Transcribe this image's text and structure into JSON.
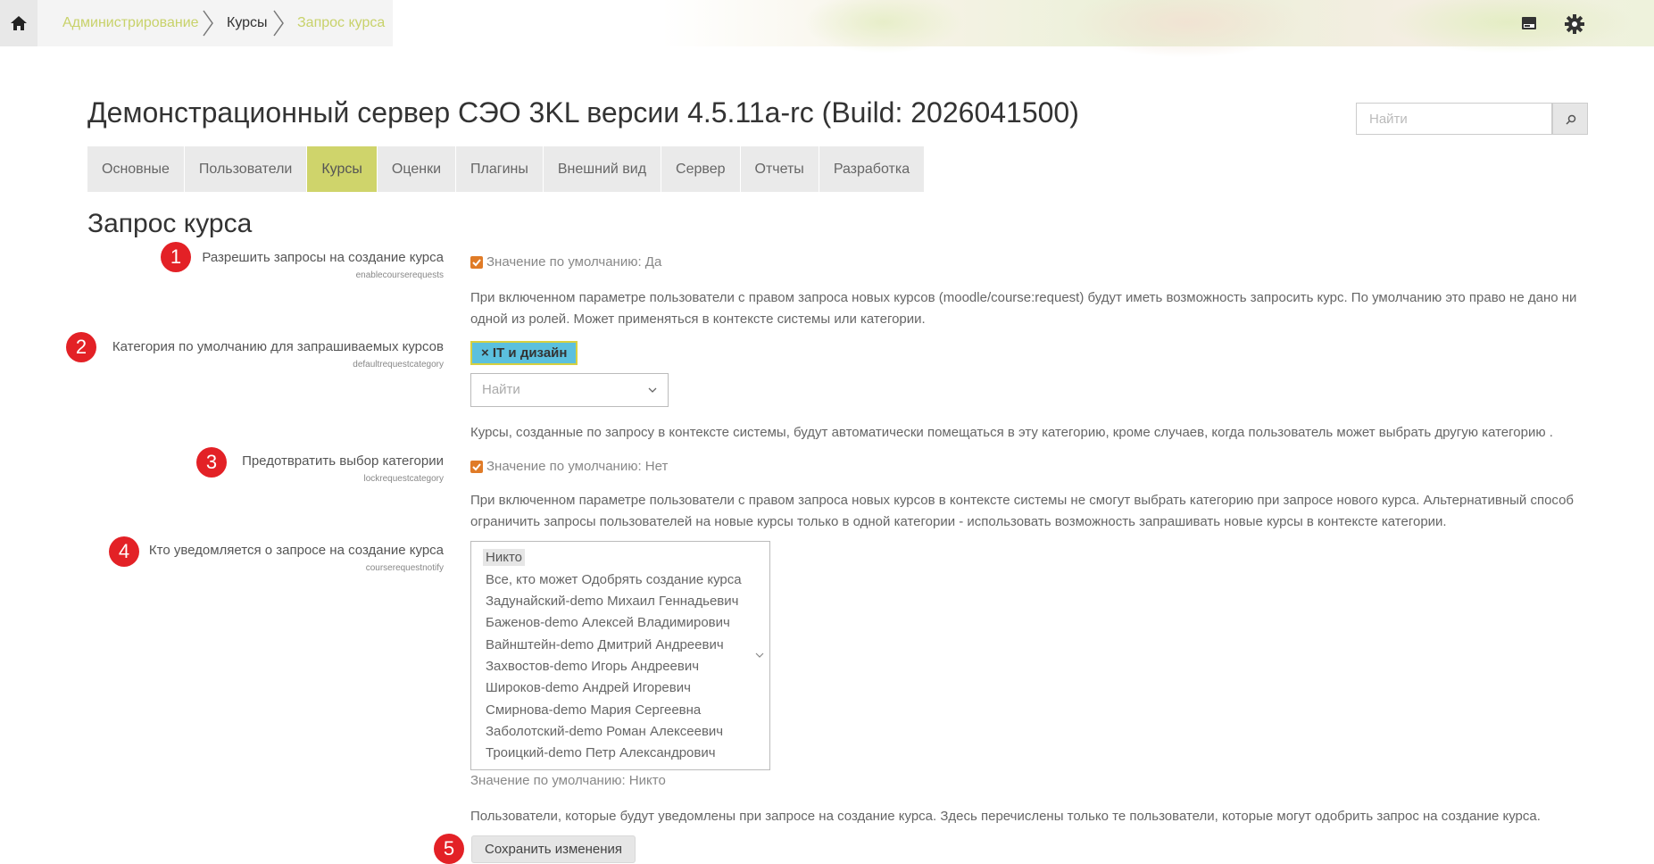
{
  "breadcrumb": {
    "items": [
      {
        "label": "Администрирование"
      },
      {
        "label": "Курсы"
      },
      {
        "label": "Запрос курса"
      }
    ]
  },
  "header": {
    "title": "Демонстрационный сервер СЭО 3KL версии 4.5.11a-rc (Build: 2026041500)",
    "search_placeholder": "Найти"
  },
  "tabs": [
    {
      "label": "Основные"
    },
    {
      "label": "Пользователи"
    },
    {
      "label": "Курсы",
      "active": true
    },
    {
      "label": "Оценки"
    },
    {
      "label": "Плагины"
    },
    {
      "label": "Внешний вид"
    },
    {
      "label": "Сервер"
    },
    {
      "label": "Отчеты"
    },
    {
      "label": "Разработка"
    }
  ],
  "page": {
    "heading": "Запрос курса"
  },
  "settings": {
    "s1": {
      "badge": "1",
      "label": "Разрешить запросы на создание курса",
      "key": "enablecourserequests",
      "checked": true,
      "default": "Значение по умолчанию: Да",
      "description": "При включенном параметре пользователи с правом запроса новых курсов (moodle/course:request) будут иметь возможность запросить курс. По умолчанию это право не дано ни одной из ролей. Может применяться в контексте системы или категории."
    },
    "s2": {
      "badge": "2",
      "label": "Категория по умолчанию для запрашиваемых курсов",
      "key": "defaultrequestcategory",
      "tag": "× IT и дизайн",
      "select_placeholder": "Найти",
      "description": "Курсы, созданные по запросу в контексте системы, будут автоматически помещаться в эту категорию, кроме случаев, когда пользователь может выбрать другую категорию ."
    },
    "s3": {
      "badge": "3",
      "label": "Предотвратить выбор категории",
      "key": "lockrequestcategory",
      "checked": true,
      "default": "Значение по умолчанию: Нет",
      "description": "При включенном параметре пользователи с правом запроса новых курсов в контексте системы не смогут выбрать категорию при запросе нового курса. Альтернативный способ ограничить запросы пользователей на новые курсы только в одной категории - использовать возможность запрашивать новые курсы в контексте категории."
    },
    "s4": {
      "badge": "4",
      "label": "Кто уведомляется о запросе на создание курса",
      "key": "courserequestnotify",
      "options": [
        "Никто",
        "Все, кто может Одобрять создание курса",
        "Задунайский-demo Михаил Геннадьевич",
        "Баженов-demo Алексей Владимирович",
        "Вайнштейн-demo Дмитрий Андреевич",
        "Захвостов-demo Игорь Андреевич",
        "Широков-demo Андрей Игоревич",
        "Смирнова-demo Мария Сергеевна",
        "Заболотский-demo Роман Алексеевич",
        "Троицкий-demo Петр Александрович"
      ],
      "default": "Значение по умолчанию: Никто",
      "description": "Пользователи, которые будут уведомлены при запросе на создание курса. Здесь перечислены только те пользователи, которые могут одобрить запрос на создание курса."
    }
  },
  "footer": {
    "badge": "5",
    "save_label": "Сохранить изменения"
  },
  "colors": {
    "accent": "#cfd46b",
    "breadcrumb_link": "#c8d26a",
    "badge": "#e32126",
    "checkbox": "#e07b27",
    "tag": "#5bc0de"
  }
}
